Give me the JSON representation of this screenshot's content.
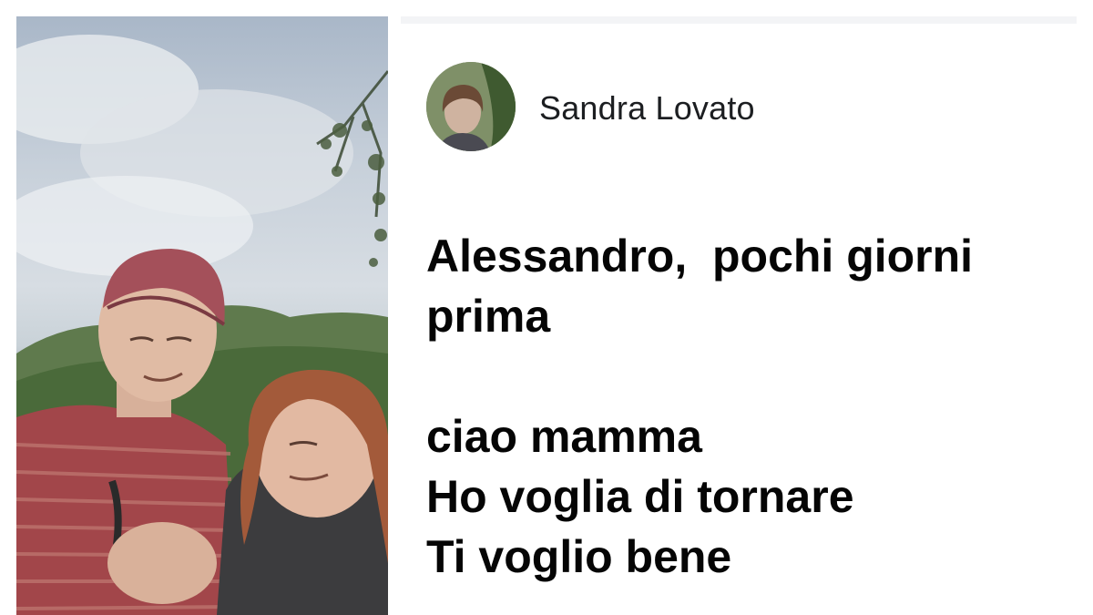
{
  "post": {
    "author_name": "Sandra Lovato",
    "text_lines": [
      "Alessandro,  pochi giorni",
      "prima",
      "",
      "ciao mamma",
      "Ho voglia di tornare",
      "Ti voglio bene"
    ]
  },
  "icons": {
    "avatar": "profile-photo"
  },
  "colors": {
    "text": "#050505",
    "author": "#1c1e21",
    "background": "#ffffff"
  }
}
